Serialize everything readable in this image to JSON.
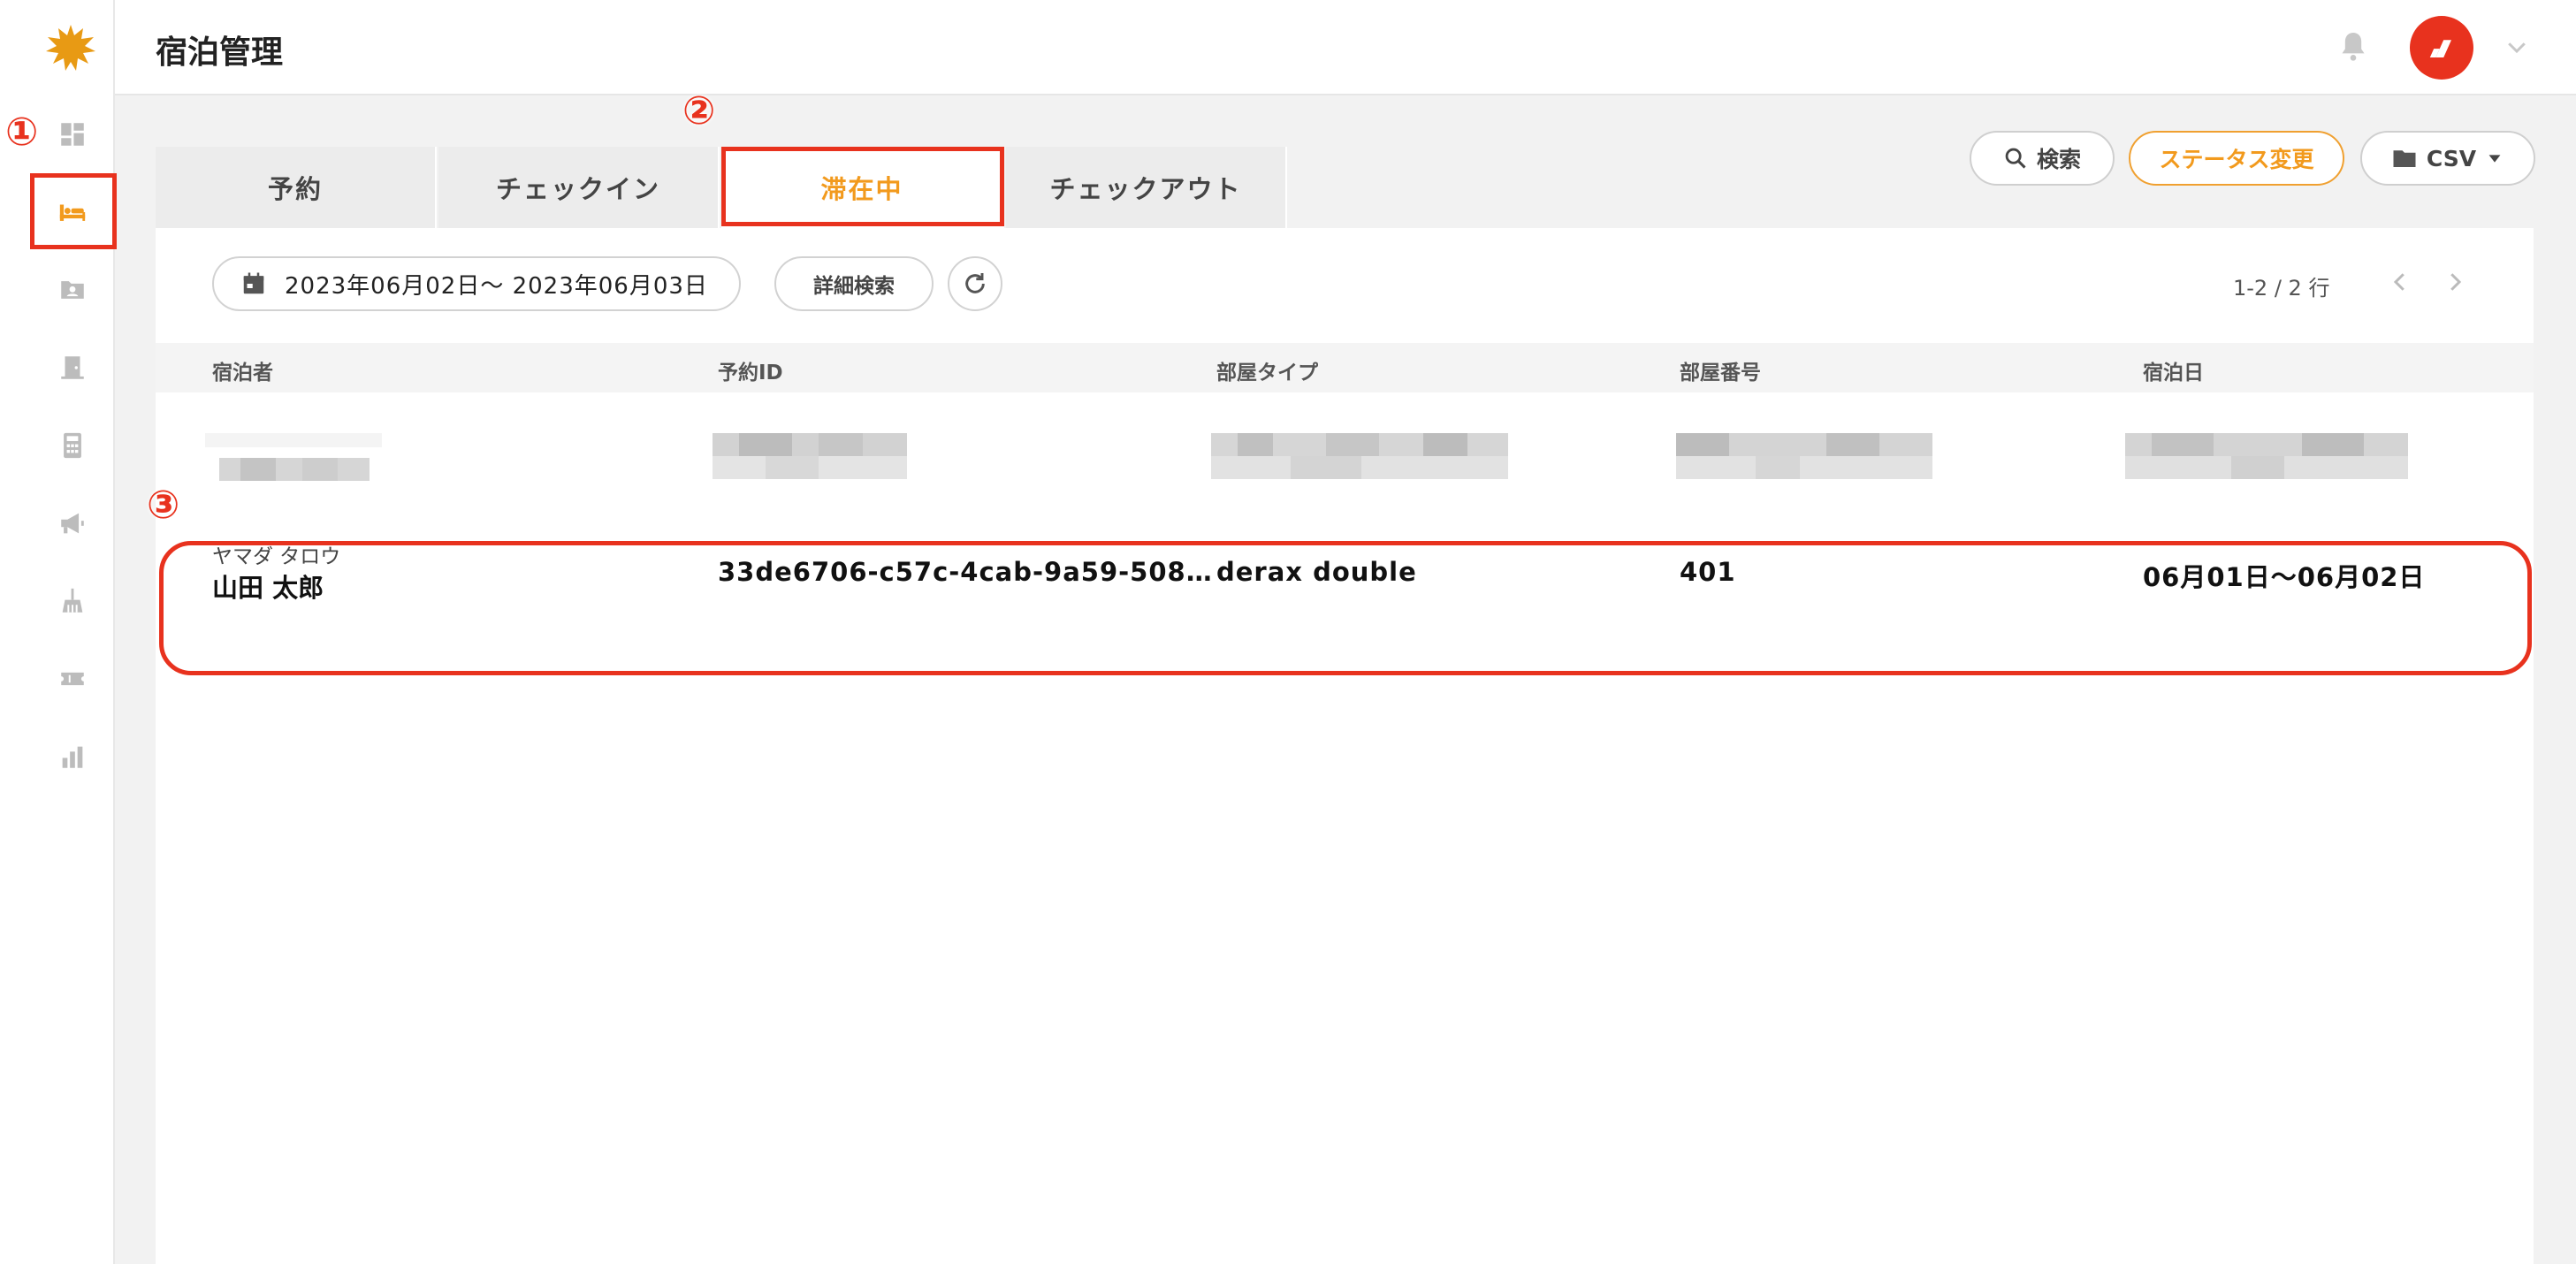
{
  "header": {
    "title": "宿泊管理"
  },
  "markers": [
    "①",
    "②",
    "③"
  ],
  "colors": {
    "accent": "#f29a1d",
    "highlight": "#e8321e"
  },
  "toolbar": {
    "search_label": "検索",
    "status_label": "ステータス変更",
    "csv_label": "CSV"
  },
  "tabs": [
    {
      "label": "予約"
    },
    {
      "label": "チェックイン"
    },
    {
      "label": "滞在中"
    },
    {
      "label": "チェックアウト"
    }
  ],
  "filter": {
    "date_range": "2023年06月02日～ 2023年06月03日",
    "detail_search_label": "詳細検索"
  },
  "pager": {
    "text": "1-2 / 2 行"
  },
  "table": {
    "columns": [
      "宿泊者",
      "予約ID",
      "部屋タイプ",
      "部屋番号",
      "宿泊日"
    ],
    "rows": [
      {
        "kana": "ヤマダ タロウ",
        "name": "山田 太郎",
        "reservation_id": "33de6706-c57c-4cab-9a59-508…",
        "room_type": "derax double",
        "room_number": "401",
        "stay_dates": "06月01日～06月02日"
      }
    ]
  },
  "sidebar": {
    "icons": [
      "dashboard-icon",
      "bed-icon",
      "guest-card-icon",
      "door-icon",
      "calculator-icon",
      "megaphone-icon",
      "broom-icon",
      "ticket-icon",
      "bar-chart-icon"
    ]
  }
}
